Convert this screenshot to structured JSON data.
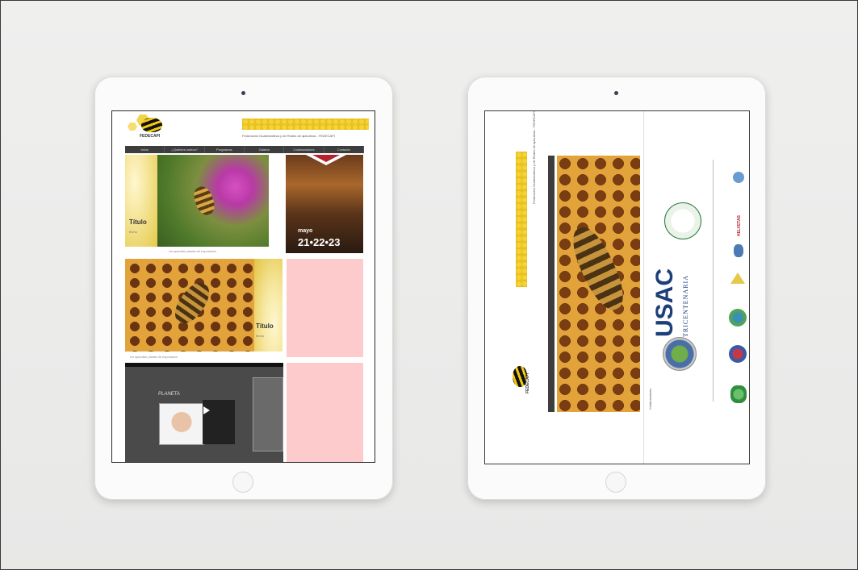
{
  "left_site": {
    "logo_text": "FEDECAPI",
    "tagline": "Federación Guatemalteca y de Redes de apicultura - FEDECAPI",
    "nav": [
      "Inicio",
      "¿Quiénes somos?",
      "Programas",
      "Galería",
      "Colaboradores",
      "Contacto"
    ],
    "tile1": {
      "title": "Título",
      "sub": "fecha",
      "caption": "Un apicultor planta de exposición"
    },
    "event": {
      "month": "mayo",
      "dates": "21•22•23"
    },
    "tile2": {
      "title": "Título",
      "sub": "fecha",
      "caption": "Un apicultor planta de exposición"
    },
    "video_title": "PLANETA"
  },
  "right_site": {
    "logo_text": "FEDECAPI",
    "tagline": "Federación Guatemalteca y de Redes de apicultura - FEDECAPI",
    "nav": [
      "Inicio",
      "¿Quiénes somos?",
      "Programas",
      "Galería",
      "Colaboradores",
      "Contacto"
    ],
    "section_label": "Colaboradores",
    "usac": "USAC",
    "usac_sub": "TRICENTENARIA",
    "partner1": "HELVETAS"
  }
}
